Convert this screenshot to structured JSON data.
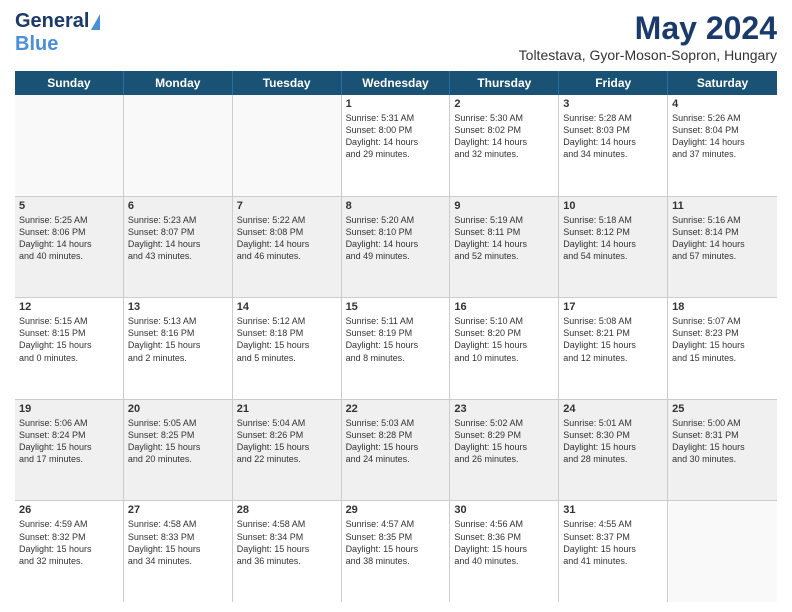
{
  "header": {
    "logo_general": "General",
    "logo_blue": "Blue",
    "month_year": "May 2024",
    "location": "Toltestava, Gyor-Moson-Sopron, Hungary"
  },
  "weekdays": [
    "Sunday",
    "Monday",
    "Tuesday",
    "Wednesday",
    "Thursday",
    "Friday",
    "Saturday"
  ],
  "rows": [
    [
      {
        "day": "",
        "info": "",
        "empty": true
      },
      {
        "day": "",
        "info": "",
        "empty": true
      },
      {
        "day": "",
        "info": "",
        "empty": true
      },
      {
        "day": "1",
        "info": "Sunrise: 5:31 AM\nSunset: 8:00 PM\nDaylight: 14 hours\nand 29 minutes."
      },
      {
        "day": "2",
        "info": "Sunrise: 5:30 AM\nSunset: 8:02 PM\nDaylight: 14 hours\nand 32 minutes."
      },
      {
        "day": "3",
        "info": "Sunrise: 5:28 AM\nSunset: 8:03 PM\nDaylight: 14 hours\nand 34 minutes."
      },
      {
        "day": "4",
        "info": "Sunrise: 5:26 AM\nSunset: 8:04 PM\nDaylight: 14 hours\nand 37 minutes."
      }
    ],
    [
      {
        "day": "5",
        "info": "Sunrise: 5:25 AM\nSunset: 8:06 PM\nDaylight: 14 hours\nand 40 minutes.",
        "shaded": true
      },
      {
        "day": "6",
        "info": "Sunrise: 5:23 AM\nSunset: 8:07 PM\nDaylight: 14 hours\nand 43 minutes.",
        "shaded": true
      },
      {
        "day": "7",
        "info": "Sunrise: 5:22 AM\nSunset: 8:08 PM\nDaylight: 14 hours\nand 46 minutes.",
        "shaded": true
      },
      {
        "day": "8",
        "info": "Sunrise: 5:20 AM\nSunset: 8:10 PM\nDaylight: 14 hours\nand 49 minutes.",
        "shaded": true
      },
      {
        "day": "9",
        "info": "Sunrise: 5:19 AM\nSunset: 8:11 PM\nDaylight: 14 hours\nand 52 minutes.",
        "shaded": true
      },
      {
        "day": "10",
        "info": "Sunrise: 5:18 AM\nSunset: 8:12 PM\nDaylight: 14 hours\nand 54 minutes.",
        "shaded": true
      },
      {
        "day": "11",
        "info": "Sunrise: 5:16 AM\nSunset: 8:14 PM\nDaylight: 14 hours\nand 57 minutes.",
        "shaded": true
      }
    ],
    [
      {
        "day": "12",
        "info": "Sunrise: 5:15 AM\nSunset: 8:15 PM\nDaylight: 15 hours\nand 0 minutes."
      },
      {
        "day": "13",
        "info": "Sunrise: 5:13 AM\nSunset: 8:16 PM\nDaylight: 15 hours\nand 2 minutes."
      },
      {
        "day": "14",
        "info": "Sunrise: 5:12 AM\nSunset: 8:18 PM\nDaylight: 15 hours\nand 5 minutes."
      },
      {
        "day": "15",
        "info": "Sunrise: 5:11 AM\nSunset: 8:19 PM\nDaylight: 15 hours\nand 8 minutes."
      },
      {
        "day": "16",
        "info": "Sunrise: 5:10 AM\nSunset: 8:20 PM\nDaylight: 15 hours\nand 10 minutes."
      },
      {
        "day": "17",
        "info": "Sunrise: 5:08 AM\nSunset: 8:21 PM\nDaylight: 15 hours\nand 12 minutes."
      },
      {
        "day": "18",
        "info": "Sunrise: 5:07 AM\nSunset: 8:23 PM\nDaylight: 15 hours\nand 15 minutes."
      }
    ],
    [
      {
        "day": "19",
        "info": "Sunrise: 5:06 AM\nSunset: 8:24 PM\nDaylight: 15 hours\nand 17 minutes.",
        "shaded": true
      },
      {
        "day": "20",
        "info": "Sunrise: 5:05 AM\nSunset: 8:25 PM\nDaylight: 15 hours\nand 20 minutes.",
        "shaded": true
      },
      {
        "day": "21",
        "info": "Sunrise: 5:04 AM\nSunset: 8:26 PM\nDaylight: 15 hours\nand 22 minutes.",
        "shaded": true
      },
      {
        "day": "22",
        "info": "Sunrise: 5:03 AM\nSunset: 8:28 PM\nDaylight: 15 hours\nand 24 minutes.",
        "shaded": true
      },
      {
        "day": "23",
        "info": "Sunrise: 5:02 AM\nSunset: 8:29 PM\nDaylight: 15 hours\nand 26 minutes.",
        "shaded": true
      },
      {
        "day": "24",
        "info": "Sunrise: 5:01 AM\nSunset: 8:30 PM\nDaylight: 15 hours\nand 28 minutes.",
        "shaded": true
      },
      {
        "day": "25",
        "info": "Sunrise: 5:00 AM\nSunset: 8:31 PM\nDaylight: 15 hours\nand 30 minutes.",
        "shaded": true
      }
    ],
    [
      {
        "day": "26",
        "info": "Sunrise: 4:59 AM\nSunset: 8:32 PM\nDaylight: 15 hours\nand 32 minutes."
      },
      {
        "day": "27",
        "info": "Sunrise: 4:58 AM\nSunset: 8:33 PM\nDaylight: 15 hours\nand 34 minutes."
      },
      {
        "day": "28",
        "info": "Sunrise: 4:58 AM\nSunset: 8:34 PM\nDaylight: 15 hours\nand 36 minutes."
      },
      {
        "day": "29",
        "info": "Sunrise: 4:57 AM\nSunset: 8:35 PM\nDaylight: 15 hours\nand 38 minutes."
      },
      {
        "day": "30",
        "info": "Sunrise: 4:56 AM\nSunset: 8:36 PM\nDaylight: 15 hours\nand 40 minutes."
      },
      {
        "day": "31",
        "info": "Sunrise: 4:55 AM\nSunset: 8:37 PM\nDaylight: 15 hours\nand 41 minutes."
      },
      {
        "day": "",
        "info": "",
        "empty": true
      }
    ]
  ]
}
